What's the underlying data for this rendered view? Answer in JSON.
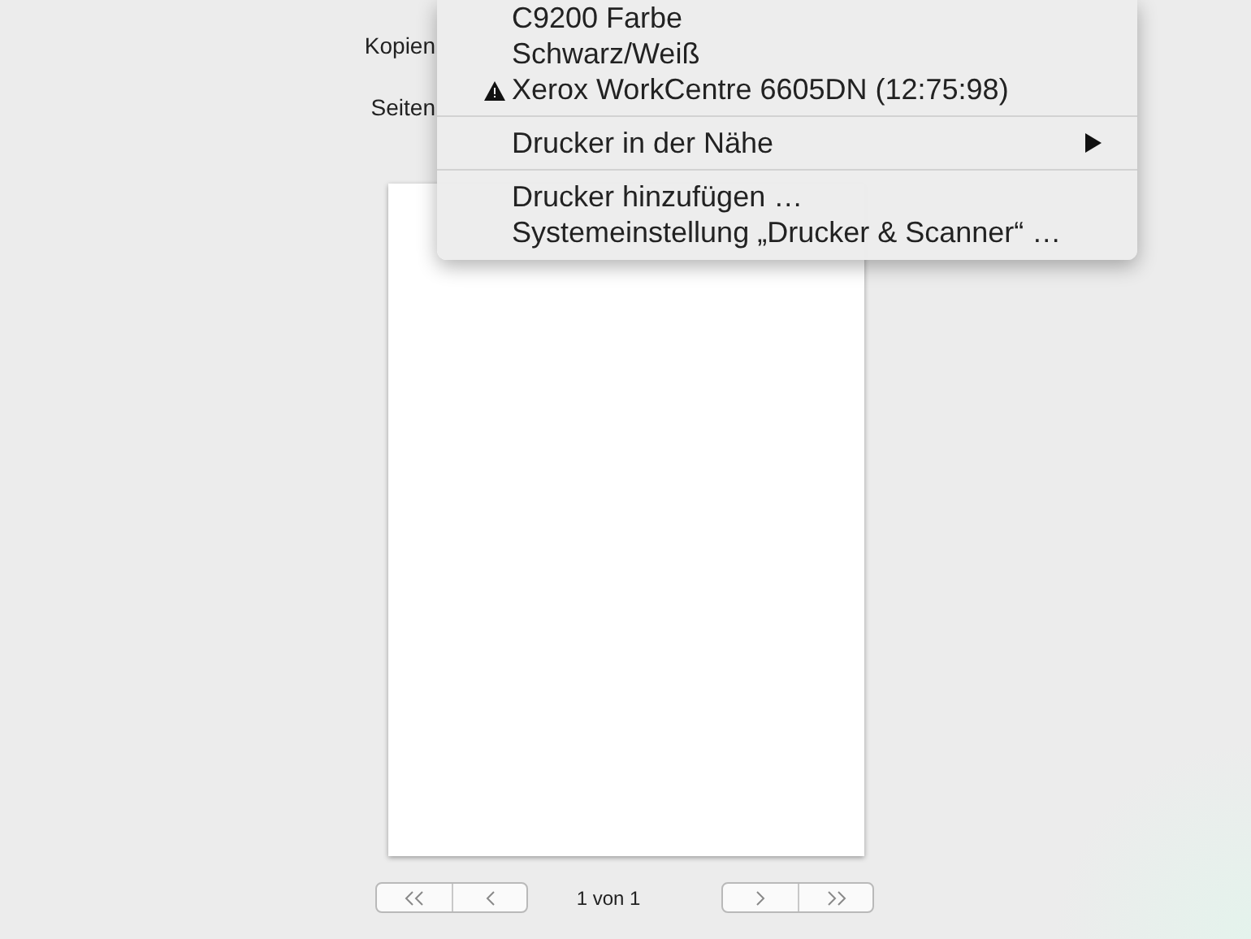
{
  "labels": [
    "Kopien",
    "Seiten"
  ],
  "printer_menu": {
    "sections": [
      [
        {
          "label": "C9200 Farbe",
          "warning": false,
          "submenu": false
        },
        {
          "label": "Schwarz/Weiß",
          "warning": false,
          "submenu": false
        },
        {
          "label": "Xerox WorkCentre 6605DN (12:75:98)",
          "warning": true,
          "submenu": false
        }
      ],
      [
        {
          "label": "Drucker in der Nähe",
          "warning": false,
          "submenu": true
        }
      ],
      [
        {
          "label": "Drucker hinzufügen …",
          "warning": false,
          "submenu": false
        },
        {
          "label": "Systemeinstellung „Drucker & Scanner“ …",
          "warning": false,
          "submenu": false
        }
      ]
    ]
  },
  "pager": {
    "text": "1 von 1"
  }
}
